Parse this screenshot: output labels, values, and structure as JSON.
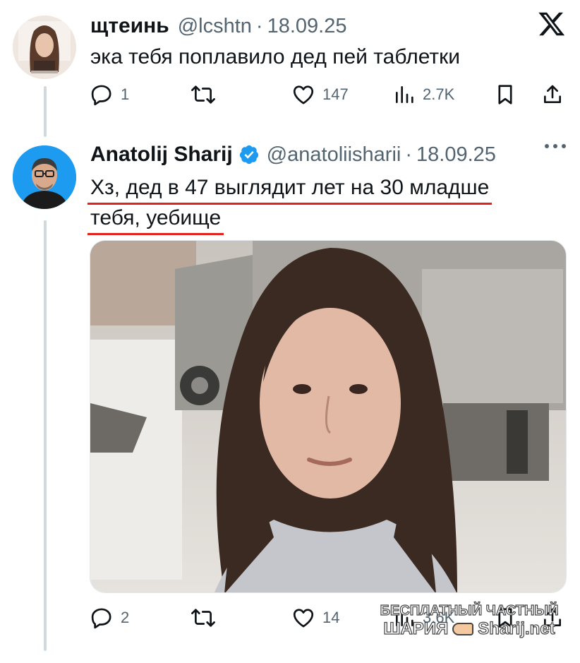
{
  "reply_tweet": {
    "name": "щтеинь",
    "handle": "@lcshtn",
    "date": "18.09.25",
    "text": "эка тебя поплавило дед пей таблетки",
    "stats": {
      "replies": "1",
      "likes": "147",
      "views": "2.7K"
    }
  },
  "main_tweet": {
    "name": "Anatolij Sharij",
    "handle": "@anatoliisharii",
    "date": "18.09.25",
    "text_line1": "Хз, дед в 47 выглядит лет на 30 младше",
    "text_line2": "тебя, уебище",
    "stats": {
      "replies": "2",
      "likes": "14",
      "views": "3.6K"
    }
  },
  "watermark": {
    "line1": "БЕСПЛАТНЫЙ ЧАСТНЫЙ",
    "left": "ШАРИЯ",
    "right": "Sharij.net"
  },
  "colors": {
    "text": "#0f1419",
    "muted": "#536471",
    "verified": "#1d9bf0",
    "underline": "#e0231c",
    "thread_line": "#cfd9de"
  },
  "icons": [
    "x-logo-icon",
    "reply-icon",
    "retweet-icon",
    "like-icon",
    "views-icon",
    "bookmark-icon",
    "share-icon",
    "more-icon",
    "verified-badge-icon"
  ]
}
